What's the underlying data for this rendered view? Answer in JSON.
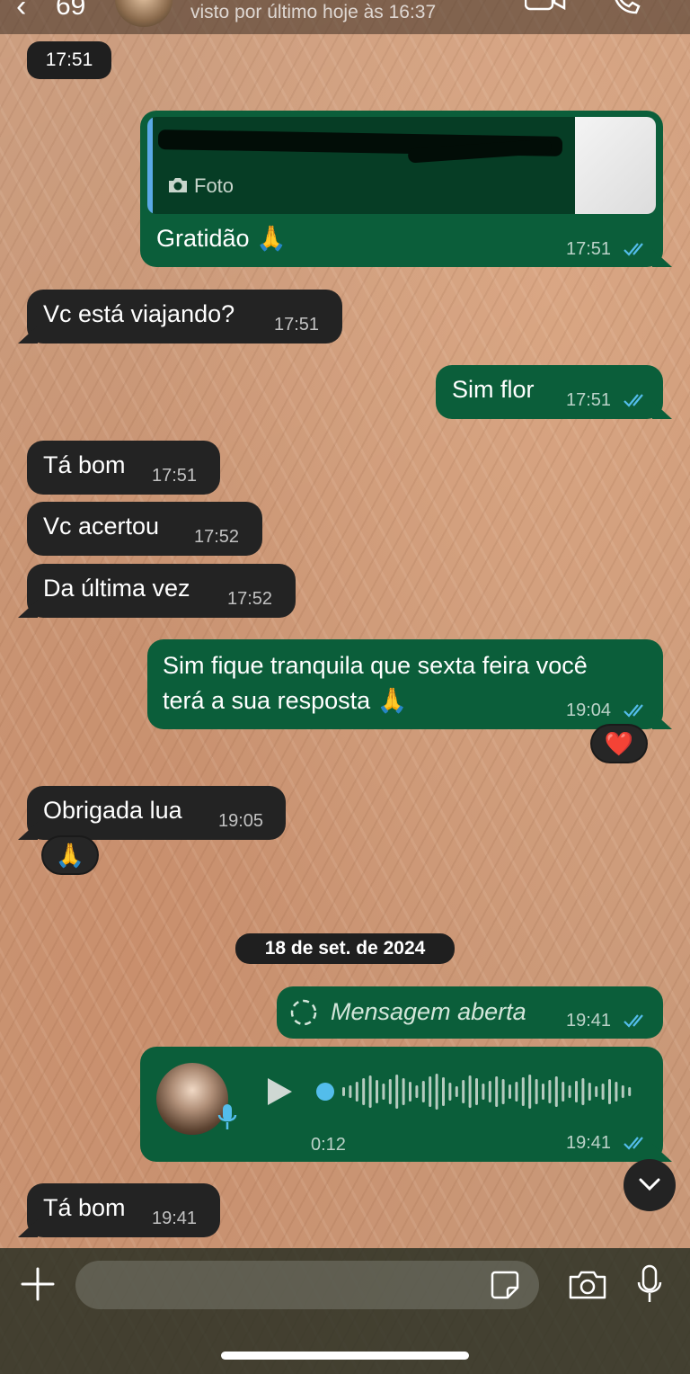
{
  "header": {
    "back_icon": "chevron-left-icon",
    "unread_count": "69",
    "last_seen": "visto por último hoje às 16:37",
    "video_icon": "video-camera-icon",
    "call_icon": "phone-icon"
  },
  "colors": {
    "incoming_bubble": "#232323",
    "outgoing_bubble": "#0b5e3a",
    "read_ticks": "#53bdeb"
  },
  "messages": {
    "m0_time": "17:51",
    "m1": {
      "quote_label": "Foto",
      "text": "Gratidão 🙏",
      "time": "17:51"
    },
    "m2": {
      "text": "Vc está viajando?",
      "time": "17:51"
    },
    "m3": {
      "text": "Sim flor",
      "time": "17:51"
    },
    "m4": {
      "text": "Tá bom",
      "time": "17:51"
    },
    "m5": {
      "text": "Vc acertou",
      "time": "17:52"
    },
    "m6": {
      "text": "Da última vez",
      "time": "17:52"
    },
    "m7": {
      "line1": "Sim fique tranquila que sexta feira você",
      "line2": "terá a sua resposta 🙏",
      "time": "19:04",
      "reaction": "❤️"
    },
    "m8": {
      "text": "Obrigada lua",
      "time": "19:05",
      "reaction": "🙏"
    },
    "date_divider": "18 de set. de 2024",
    "m9": {
      "text": "Mensagem aberta",
      "time": "19:41"
    },
    "m10": {
      "duration": "0:12",
      "time": "19:41"
    },
    "m11": {
      "text": "Tá bom",
      "time": "19:41"
    }
  },
  "input": {
    "placeholder": "",
    "plus_icon": "plus-icon",
    "sticker_icon": "sticker-icon",
    "camera_icon": "camera-icon",
    "mic_icon": "microphone-icon"
  }
}
